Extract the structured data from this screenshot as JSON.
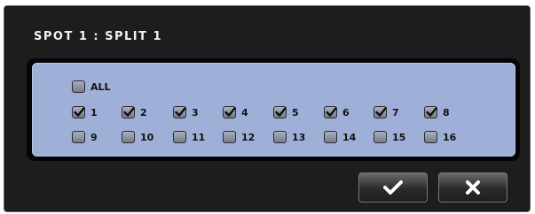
{
  "dialog": {
    "title": "SPOT 1 : SPLIT 1"
  },
  "all": {
    "label": "ALL",
    "checked": false
  },
  "cameras": [
    {
      "label": "1",
      "checked": true
    },
    {
      "label": "2",
      "checked": true
    },
    {
      "label": "3",
      "checked": true
    },
    {
      "label": "4",
      "checked": true
    },
    {
      "label": "5",
      "checked": true
    },
    {
      "label": "6",
      "checked": true
    },
    {
      "label": "7",
      "checked": true
    },
    {
      "label": "8",
      "checked": true
    },
    {
      "label": "9",
      "checked": false
    },
    {
      "label": "10",
      "checked": false
    },
    {
      "label": "11",
      "checked": false
    },
    {
      "label": "12",
      "checked": false
    },
    {
      "label": "13",
      "checked": false
    },
    {
      "label": "14",
      "checked": false
    },
    {
      "label": "15",
      "checked": false
    },
    {
      "label": "16",
      "checked": false
    }
  ],
  "buttons": {
    "confirm_icon": "checkmark-icon",
    "cancel_icon": "close-icon"
  },
  "colors": {
    "dialog_bg": "#1d1d1d",
    "panel_bg": "#9fb0d8"
  }
}
